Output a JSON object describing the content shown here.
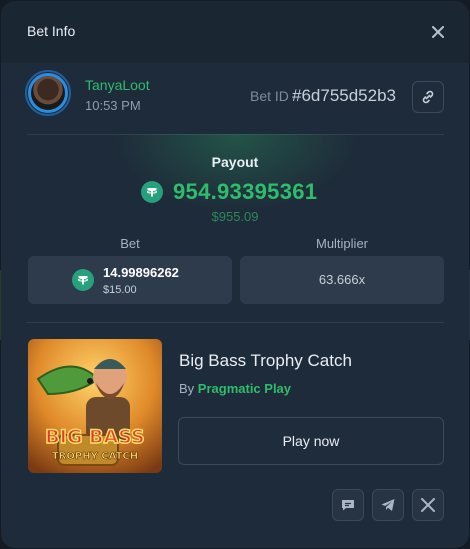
{
  "modal": {
    "title": "Bet Info"
  },
  "user": {
    "name": "TanyaLoot",
    "time": "10:53 PM"
  },
  "bet_id": {
    "label": "Bet ID",
    "value": "#6d755d52b3"
  },
  "payout": {
    "label": "Payout",
    "amount": "954.93395361",
    "usd": "$955.09",
    "currency_icon": "tether-icon"
  },
  "bet": {
    "label": "Bet",
    "amount": "14.99896262",
    "usd": "$15.00"
  },
  "multiplier": {
    "label": "Multiplier",
    "value": "63.666x"
  },
  "game": {
    "title": "Big Bass Trophy Catch",
    "provider_prefix": "By",
    "provider": "Pragmatic Play",
    "thumb_line1": "BIG BASS",
    "thumb_line2": "TROPHY CATCH"
  },
  "actions": {
    "play_label": "Play now"
  },
  "share": [
    "chat-icon",
    "telegram-icon",
    "x-icon"
  ],
  "colors": {
    "accent_green": "#2fbd6b",
    "tether": "#26a17b",
    "panel": "#1e2b3a"
  }
}
